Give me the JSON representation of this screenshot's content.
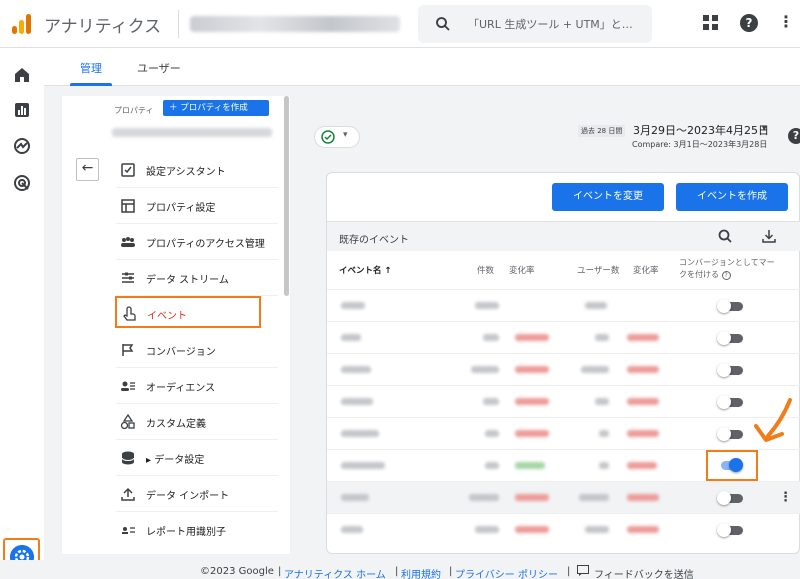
{
  "header": {
    "app_title": "アナリティクス",
    "search_placeholder": "「URL 生成ツール + UTM」と…",
    "icons": [
      "apps-icon",
      "help-icon",
      "more-vert-icon"
    ]
  },
  "rail": {
    "icons": [
      "home-icon",
      "reports-icon",
      "explore-icon",
      "advertising-icon",
      "admin-gear-icon"
    ]
  },
  "tabs": [
    {
      "label": "管理",
      "active": true
    },
    {
      "label": "ユーザー",
      "active": false
    }
  ],
  "property": {
    "label": "プロパティ",
    "create_button": "＋ プロパティを作成"
  },
  "settings_menu": [
    {
      "label": "設定アシスタント",
      "icon": "checklist-icon"
    },
    {
      "label": "プロパティ設定",
      "icon": "property-settings-icon"
    },
    {
      "label": "プロパティのアクセス管理",
      "icon": "people-icon"
    },
    {
      "label": "データ ストリーム",
      "icon": "data-stream-icon"
    },
    {
      "label": "イベント",
      "icon": "touch-icon",
      "selected": true
    },
    {
      "label": "コンバージョン",
      "icon": "flag-icon"
    },
    {
      "label": "オーディエンス",
      "icon": "audience-icon"
    },
    {
      "label": "カスタム定義",
      "icon": "custom-definitions-icon"
    },
    {
      "label": "▸ データ設定",
      "icon": "database-icon"
    },
    {
      "label": "データ インポート",
      "icon": "upload-icon"
    },
    {
      "label": "レポート用識別子",
      "icon": "identity-icon"
    }
  ],
  "date": {
    "tag": "過去 28 日間",
    "range": "3月29日～2023年4月25日",
    "compare": "Compare: 3月1日～2023年3月28日"
  },
  "events_card": {
    "modify_button": "イベントを変更",
    "create_button": "イベントを作成",
    "title": "既存のイベント",
    "columns": {
      "name": "イベント名 ↑",
      "count": "件数",
      "count_change": "変化率",
      "users": "ユーザー数",
      "users_change": "変化率",
      "conversion": [
        "コンバージョンとしてマー",
        "クを付ける"
      ]
    },
    "rows": [
      {
        "conversion": false
      },
      {
        "conversion": false
      },
      {
        "conversion": false
      },
      {
        "conversion": false
      },
      {
        "conversion": false
      },
      {
        "conversion": true,
        "highlighted_toggle": true
      },
      {
        "conversion": false,
        "hover": true
      },
      {
        "conversion": false
      }
    ]
  },
  "footer": {
    "copyright": "©2023 Google",
    "sep": "|",
    "home_link": "アナリティクス ホーム",
    "terms_link": "利用規約",
    "privacy_link": "プライバシー ポリシー",
    "feedback": "フィードバックを送信"
  }
}
